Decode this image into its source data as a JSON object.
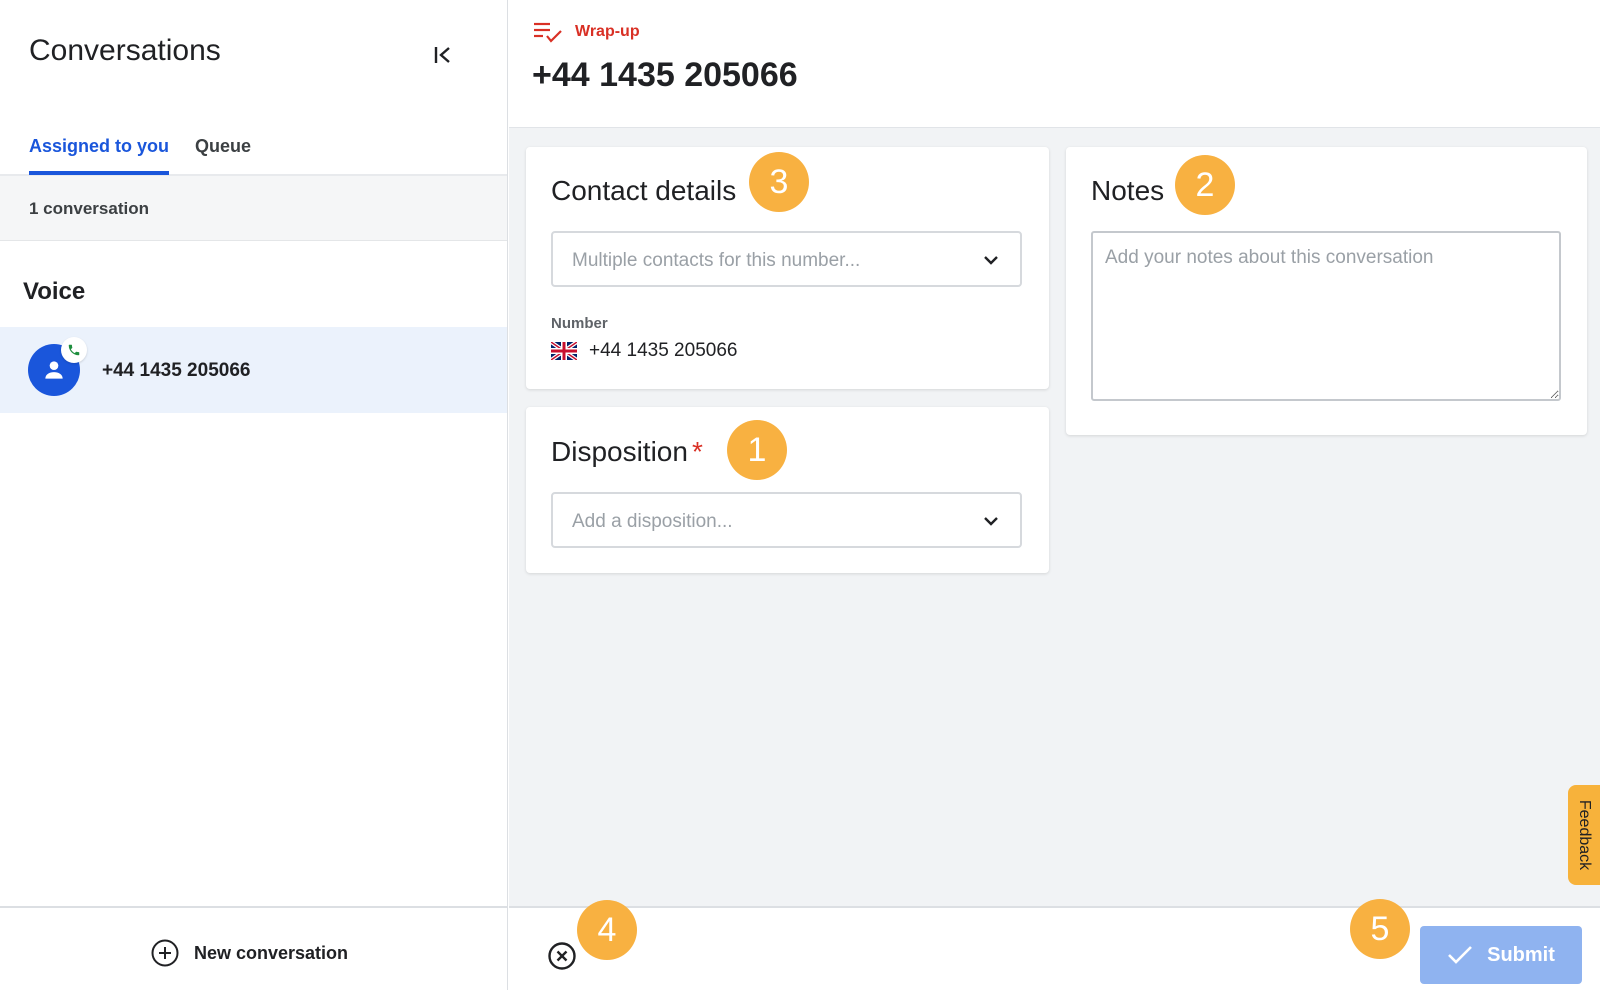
{
  "sidebar": {
    "title": "Conversations",
    "tabs": [
      {
        "label": "Assigned to you",
        "active": true
      },
      {
        "label": "Queue",
        "active": false
      }
    ],
    "count_text": "1 conversation",
    "section_label": "Voice",
    "conversations": [
      {
        "number": "+44 1435 205066",
        "icon": "person-icon",
        "badge_icon": "phone-icon"
      }
    ],
    "new_conversation_label": "New conversation"
  },
  "main": {
    "status_label": "Wrap-up",
    "status_icon": "list-check-icon",
    "title": "+44 1435 205066",
    "contact_card": {
      "title": "Contact details",
      "select_placeholder": "Multiple contacts for this number...",
      "number_label": "Number",
      "number_value": "+44 1435 205066",
      "flag_icon": "uk-flag-icon"
    },
    "disposition_card": {
      "title": "Disposition",
      "required_mark": "*",
      "select_placeholder": "Add a disposition..."
    },
    "notes_card": {
      "title": "Notes",
      "placeholder": "Add your notes about this conversation"
    },
    "feedback_label": "Feedback",
    "submit_label": "Submit"
  },
  "markers": [
    "3",
    "2",
    "1",
    "4",
    "5"
  ],
  "colors": {
    "accent": "#1a56db",
    "wrap_up": "#d93025",
    "marker": "#f8b141",
    "submit_disabled": "#8fb3f0",
    "selected_row": "#ebf2fc"
  }
}
